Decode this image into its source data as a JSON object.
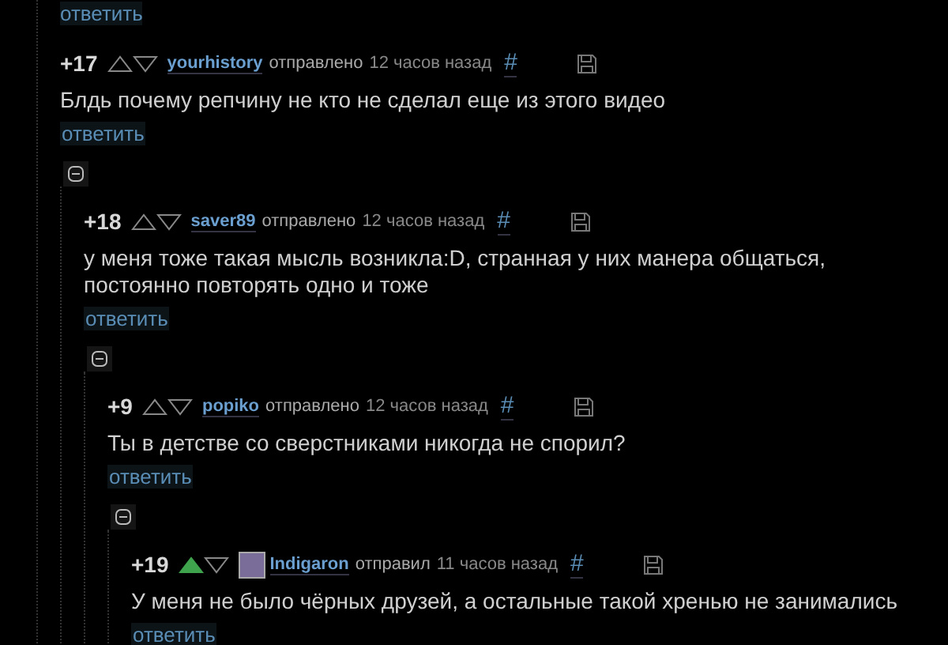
{
  "top_reply_link": "ответить",
  "thread": {
    "rating": "+17",
    "upvoted": false,
    "author": "yourhistory",
    "avatar": false,
    "verb": "отправлено",
    "time": "12 часов назад",
    "anchor": "#",
    "text": "Блдь почему репчину не кто не сделал еще из этого видео",
    "reply": "ответить",
    "expanded": true,
    "children": [
      {
        "rating": "+18",
        "upvoted": false,
        "author": "saver89",
        "avatar": false,
        "verb": "отправлено",
        "time": "12 часов назад",
        "anchor": "#",
        "text": "у меня тоже такая мысль возникла:D, странная у них манера общаться, постоянно повторять одно и тоже",
        "reply": "ответить",
        "expanded": true,
        "children": [
          {
            "rating": "+9",
            "upvoted": false,
            "author": "popiko",
            "avatar": false,
            "verb": "отправлено",
            "time": "12 часов назад",
            "anchor": "#",
            "text": "Ты в детстве со сверстниками никогда не спорил?",
            "reply": "ответить",
            "expanded": true,
            "children": [
              {
                "rating": "+19",
                "upvoted": true,
                "author": "Indigaron",
                "avatar": true,
                "verb": "отправил",
                "time": "11 часов назад",
                "anchor": "#",
                "text": "У меня не было чёрных друзей, а остальные такой хренью не занимались",
                "reply": "ответить"
              }
            ]
          }
        ]
      }
    ]
  }
}
